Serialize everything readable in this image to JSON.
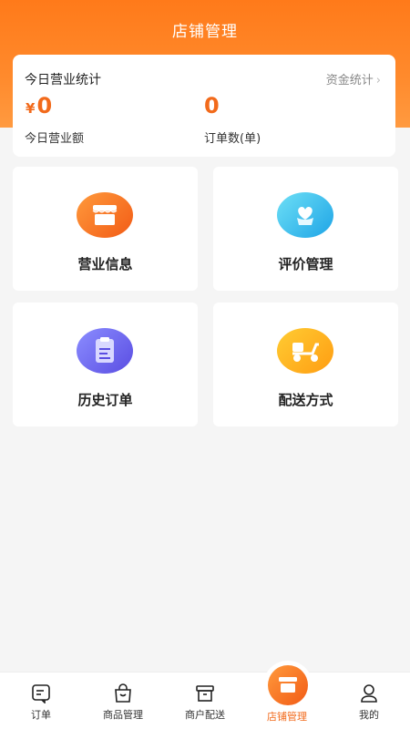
{
  "header": {
    "title": "店铺管理"
  },
  "stats": {
    "title": "今日营业统计",
    "funds_link": "资金统计",
    "revenue_currency": "¥",
    "revenue_value": "0",
    "revenue_label": "今日营业额",
    "orders_value": "0",
    "orders_label": "订单数(单)"
  },
  "tiles": [
    {
      "label": "营业信息",
      "icon": "store-icon"
    },
    {
      "label": "评价管理",
      "icon": "heart-plant-icon"
    },
    {
      "label": "历史订单",
      "icon": "clipboard-icon"
    },
    {
      "label": "配送方式",
      "icon": "scooter-icon"
    }
  ],
  "tabbar": [
    {
      "label": "订单",
      "icon": "order-icon"
    },
    {
      "label": "商品管理",
      "icon": "bag-icon"
    },
    {
      "label": "商户配送",
      "icon": "box-icon"
    },
    {
      "label": "店铺管理",
      "icon": "store-icon",
      "active": true
    },
    {
      "label": "我的",
      "icon": "person-icon"
    }
  ],
  "colors": {
    "accent": "#f26a1b",
    "header": "#ff7a1a"
  }
}
